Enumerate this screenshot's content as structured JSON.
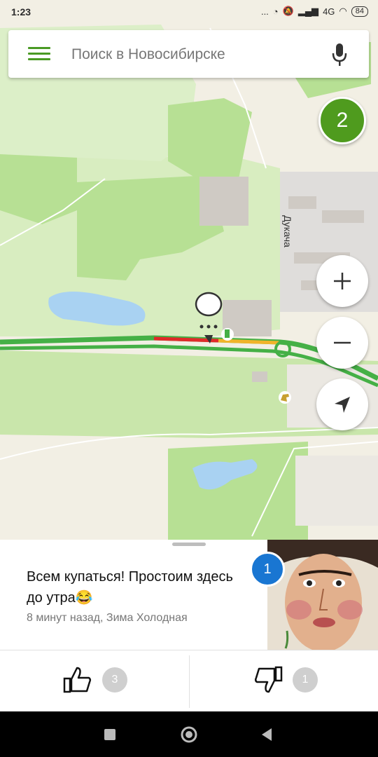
{
  "status_bar": {
    "time": "1:23",
    "indicators": "...",
    "network": "4G",
    "battery": "84"
  },
  "search": {
    "placeholder": "Поиск в Новосибирске"
  },
  "map": {
    "street_label": "Дукача",
    "cluster_count": "2",
    "icons": [
      "speech-bubble-icon",
      "fuel-station-icon",
      "horse-icon"
    ],
    "colors": {
      "road_green": "#45b046",
      "road_red": "#e02a2a",
      "road_yellow": "#f0b429",
      "accent": "#4f9b1e"
    }
  },
  "post": {
    "text": "Всем купаться! Простоим здесь до утра😂",
    "meta": "8 минут назад, Зима Холодная",
    "photo_count": "1"
  },
  "votes": {
    "likes": "3",
    "dislikes": "1"
  }
}
